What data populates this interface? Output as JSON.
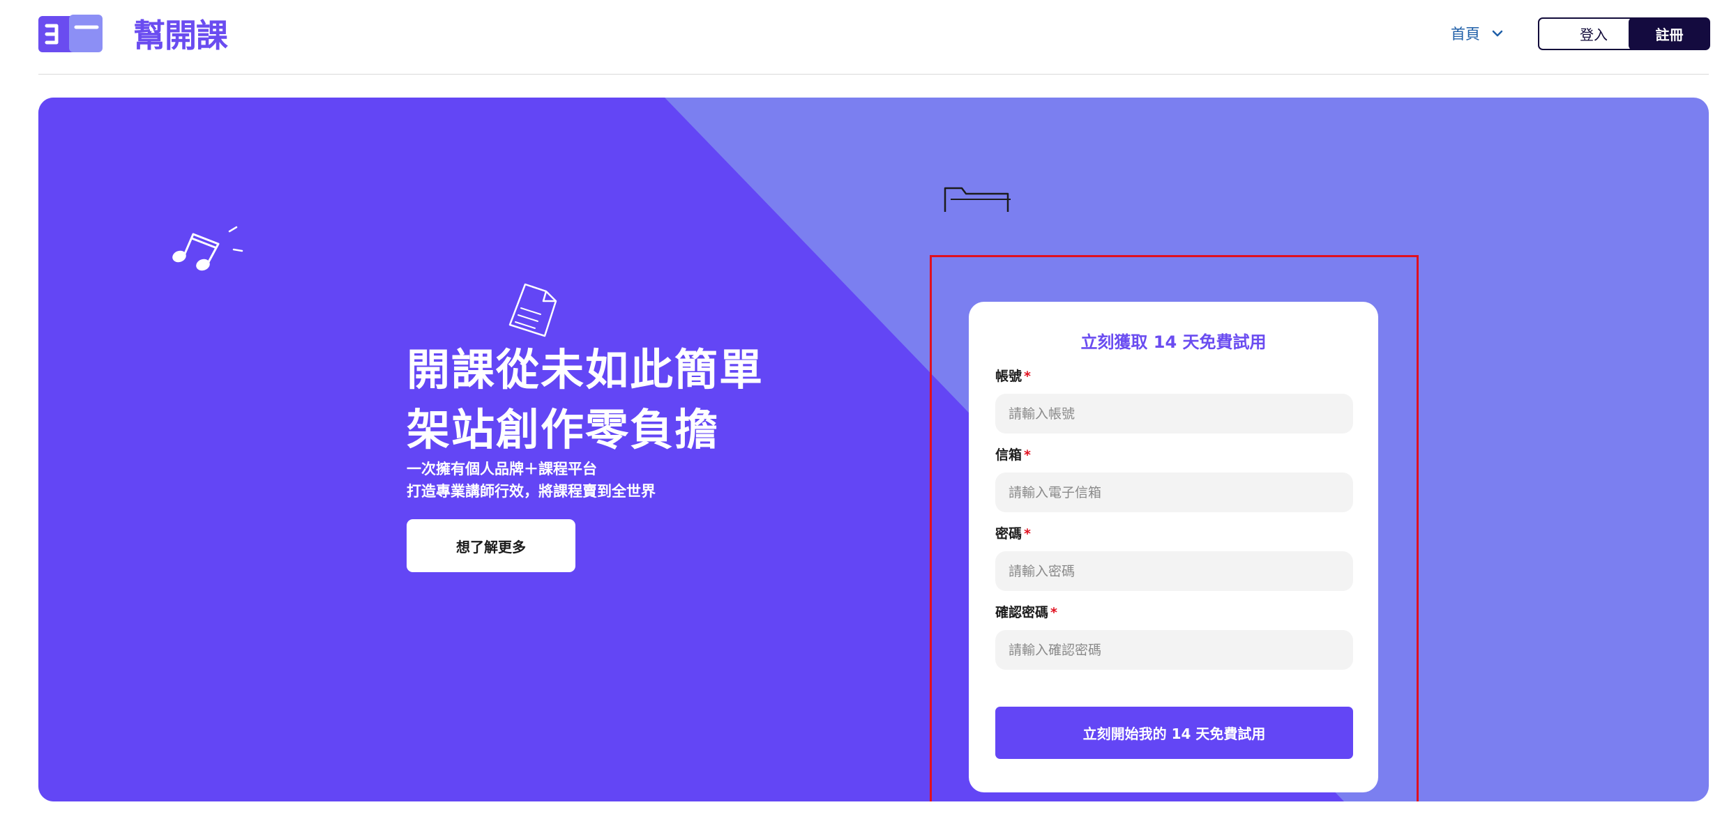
{
  "brand": {
    "name": "幫開課"
  },
  "nav": {
    "home_label": "首頁",
    "login_label": "登入",
    "register_label": "註冊"
  },
  "hero": {
    "title_line1": "開課從未如此簡單",
    "title_line2": "架站創作零負擔",
    "subtitle_line1": "一次擁有個人品牌＋課程平台",
    "subtitle_line2": "打造專業講師行效，將課程賣到全世界",
    "cta_label": "想了解更多"
  },
  "form": {
    "title": "立刻獲取 14 天免費試用",
    "account": {
      "label": "帳號",
      "required_mark": "*",
      "placeholder": "請輸入帳號",
      "value": ""
    },
    "email": {
      "label": "信箱",
      "required_mark": "*",
      "placeholder": "請輸入電子信箱",
      "value": ""
    },
    "password": {
      "label": "密碼",
      "required_mark": "*",
      "placeholder": "請輸入密碼",
      "value": ""
    },
    "confirm_password": {
      "label": "確認密碼",
      "required_mark": "*",
      "placeholder": "請輸入確認密碼",
      "value": ""
    },
    "submit_label": "立刻開始我的 14 天免費試用"
  },
  "colors": {
    "brand_purple": "#6346f5",
    "hero_light": "#7b7ff0",
    "dark_navy": "#140b3f",
    "link_blue": "#1f5fa8",
    "required_red": "#e0101f",
    "highlight_red": "#e0101f"
  },
  "icons": {
    "music": "music-note-icon",
    "document": "document-icon",
    "folder_top": "folder-icon",
    "folder_bottom": "open-folder-icon",
    "chevron": "chevron-down-icon"
  }
}
